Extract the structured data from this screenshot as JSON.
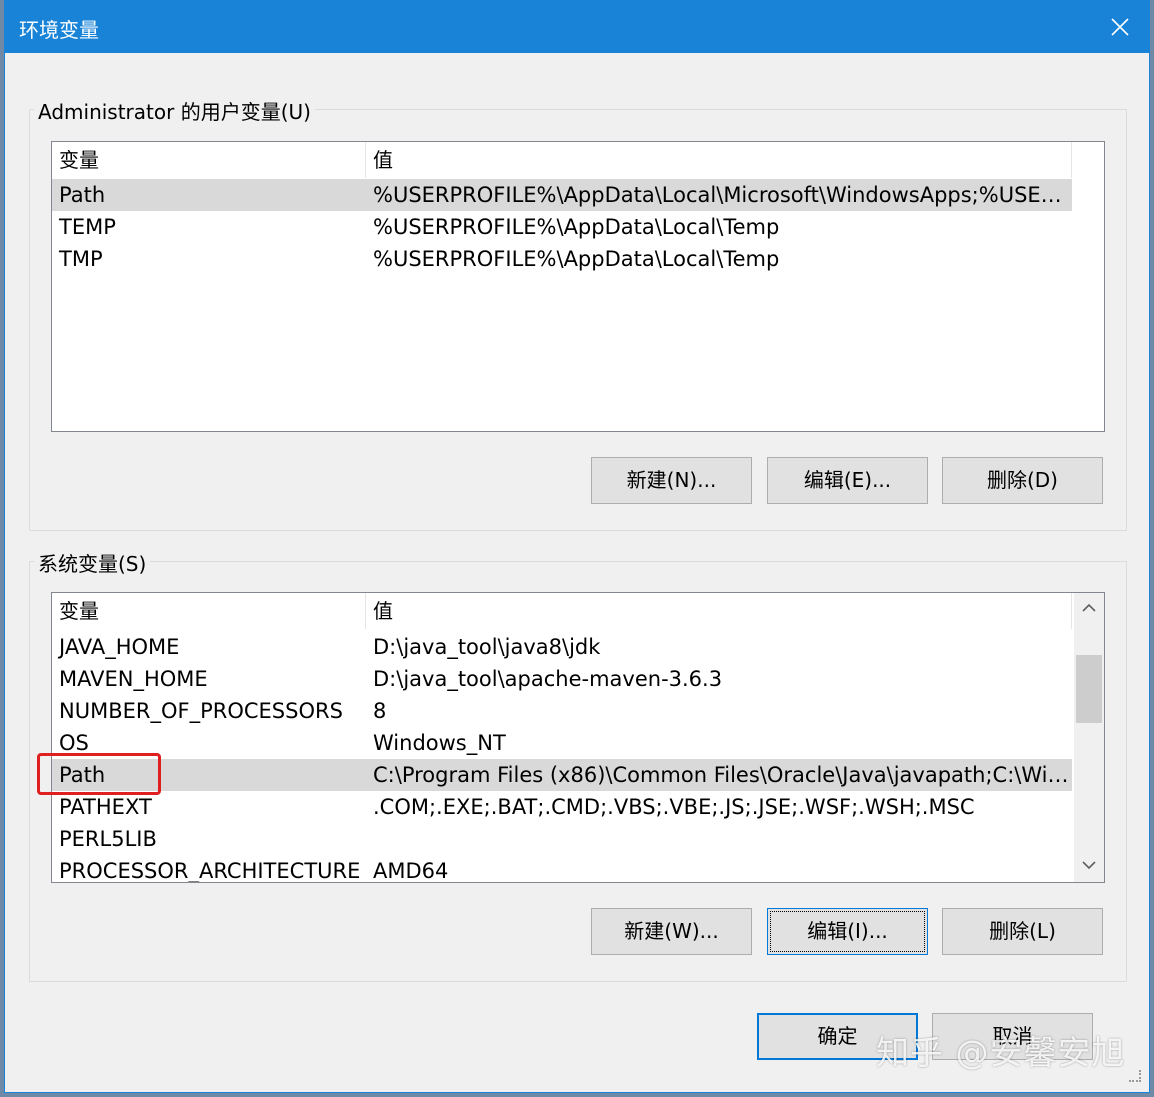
{
  "window": {
    "title": "环境变量"
  },
  "user_section": {
    "label": "Administrator 的用户变量(U)",
    "columns": [
      "变量",
      "值"
    ],
    "rows": [
      {
        "name": "Path",
        "value": "%USERPROFILE%\\AppData\\Local\\Microsoft\\WindowsApps;%USER..."
      },
      {
        "name": "TEMP",
        "value": "%USERPROFILE%\\AppData\\Local\\Temp"
      },
      {
        "name": "TMP",
        "value": "%USERPROFILE%\\AppData\\Local\\Temp"
      }
    ],
    "selected_row": 0,
    "buttons": {
      "new": "新建(N)...",
      "edit": "编辑(E)...",
      "delete": "删除(D)"
    }
  },
  "system_section": {
    "label": "系统变量(S)",
    "columns": [
      "变量",
      "值"
    ],
    "rows": [
      {
        "name": "JAVA_HOME",
        "value": "D:\\java_tool\\java8\\jdk"
      },
      {
        "name": "MAVEN_HOME",
        "value": "D:\\java_tool\\apache-maven-3.6.3"
      },
      {
        "name": "NUMBER_OF_PROCESSORS",
        "value": "8"
      },
      {
        "name": "OS",
        "value": "Windows_NT"
      },
      {
        "name": "Path",
        "value": "C:\\Program Files (x86)\\Common Files\\Oracle\\Java\\javapath;C:\\Win..."
      },
      {
        "name": "PATHEXT",
        "value": ".COM;.EXE;.BAT;.CMD;.VBS;.VBE;.JS;.JSE;.WSF;.WSH;.MSC"
      },
      {
        "name": "PERL5LIB",
        "value": ""
      },
      {
        "name": "PROCESSOR_ARCHITECTURE",
        "value": "AMD64"
      }
    ],
    "selected_row": 4,
    "buttons": {
      "new": "新建(W)...",
      "edit": "编辑(I)...",
      "delete": "删除(L)"
    }
  },
  "footer": {
    "ok": "确定",
    "cancel": "取消"
  },
  "watermark": "知乎 @安馨安旭",
  "colors": {
    "titlebar": "#1883d7",
    "highlight": "#e02020",
    "focus": "#0078d7"
  },
  "icons": {
    "close": "close-icon",
    "scroll_up": "chevron-up-icon",
    "scroll_down": "chevron-down-icon"
  }
}
